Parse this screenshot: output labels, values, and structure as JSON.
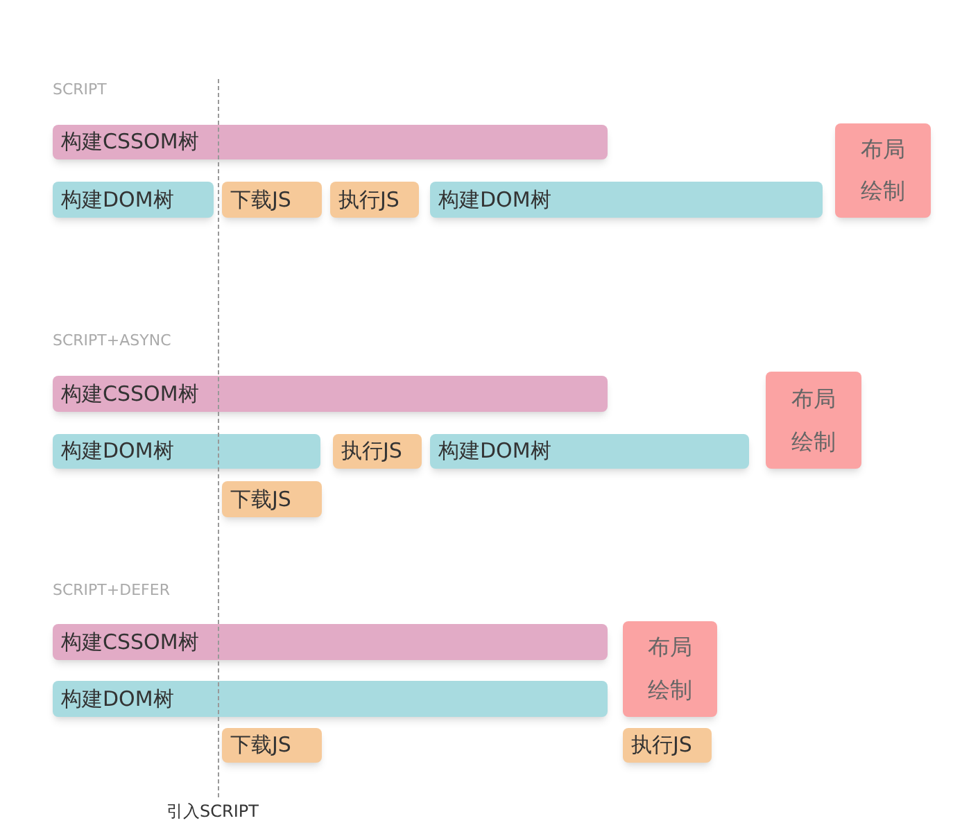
{
  "sections": [
    {
      "label": "SCRIPT",
      "blocks": [
        {
          "kind": "css",
          "text": "构建CSSOM树"
        },
        {
          "kind": "dom",
          "text": "构建DOM树"
        },
        {
          "kind": "js",
          "text": "下载JS"
        },
        {
          "kind": "js",
          "text": "执行JS"
        },
        {
          "kind": "dom",
          "text": "构建DOM树"
        },
        {
          "kind": "render",
          "lines": [
            "布局",
            "绘制"
          ]
        }
      ]
    },
    {
      "label": "SCRIPT+ASYNC",
      "blocks": [
        {
          "kind": "css",
          "text": "构建CSSOM树"
        },
        {
          "kind": "dom",
          "text": "构建DOM树"
        },
        {
          "kind": "js",
          "text": "执行JS"
        },
        {
          "kind": "dom",
          "text": "构建DOM树"
        },
        {
          "kind": "render",
          "lines": [
            "布局",
            "绘制"
          ]
        },
        {
          "kind": "js",
          "text": "下载JS"
        }
      ]
    },
    {
      "label": "SCRIPT+DEFER",
      "blocks": [
        {
          "kind": "css",
          "text": "构建CSSOM树"
        },
        {
          "kind": "dom",
          "text": "构建DOM树"
        },
        {
          "kind": "render",
          "lines": [
            "布局",
            "绘制"
          ]
        },
        {
          "kind": "js",
          "text": "下载JS"
        },
        {
          "kind": "js",
          "text": "执行JS"
        }
      ]
    }
  ],
  "marker_label": "引入SCRIPT"
}
